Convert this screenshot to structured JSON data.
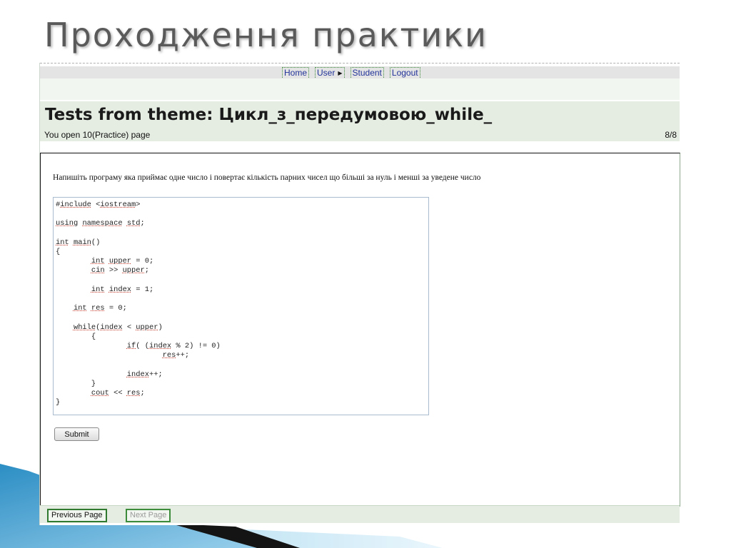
{
  "slide": {
    "title": "Проходження практики"
  },
  "nav": {
    "home": "Home",
    "user": "User",
    "user_arrow": "▶",
    "student": "Student",
    "logout": "Logout"
  },
  "header": {
    "title": "Tests from theme: Цикл_з_передумовою_while_",
    "open_info": "You open 10(Practice) page",
    "page_count": "8/8"
  },
  "question": {
    "text": "Напишіть програму яка приймає одне число і повертає кількість парних чисел що більші за нуль і менші за уведене число"
  },
  "code": {
    "lines": [
      "#include <iostream>",
      "",
      "using namespace std;",
      "",
      "int main()",
      "{",
      "        int upper = 0;",
      "        cin >> upper;",
      "",
      "        int index = 1;",
      "",
      "    int res = 0;",
      "",
      "    while(index < upper)",
      "        {",
      "                if( (index % 2) != 0)",
      "                        res++;",
      "",
      "                index++;",
      "        }",
      "        cout << res;",
      "}"
    ]
  },
  "buttons": {
    "submit": "Submit",
    "previous": "Previous Page",
    "next": "Next Page"
  },
  "colors": {
    "nav_bg": "#e4e4e4",
    "header_bg": "#e5ece2",
    "link": "#223399",
    "accent_border": "#2f7a2f"
  }
}
